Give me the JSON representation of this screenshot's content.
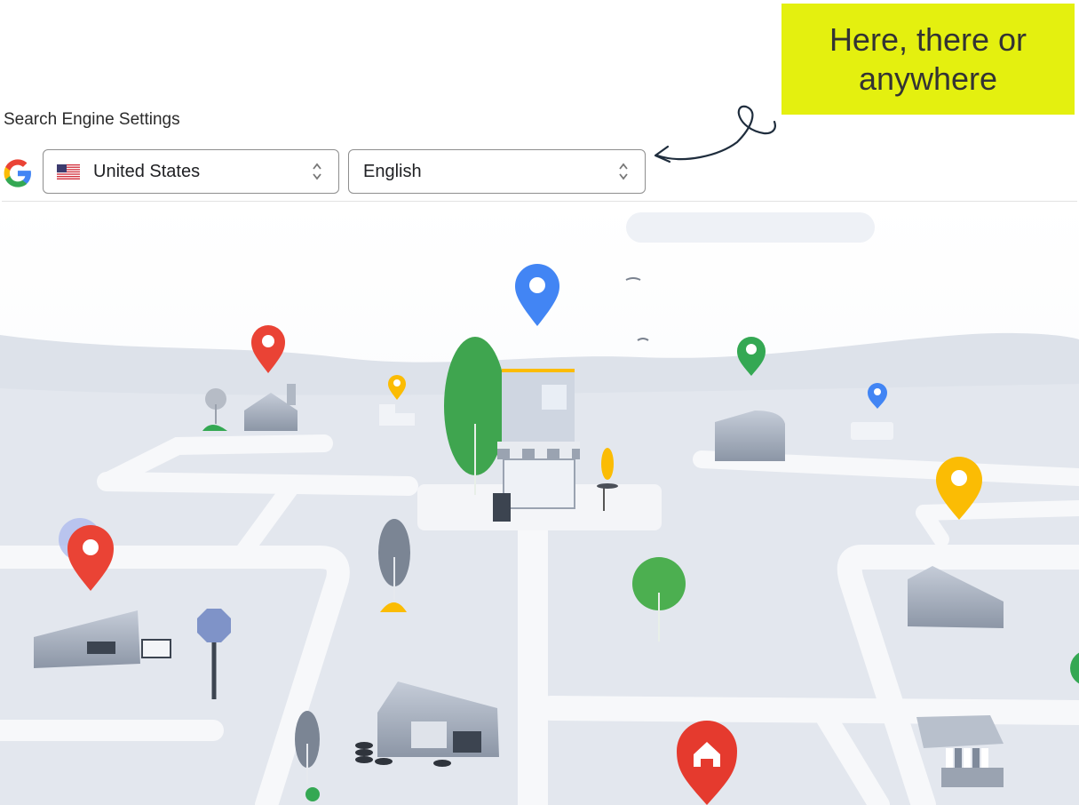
{
  "header": {
    "title": "Search Engine Settings"
  },
  "country_select": {
    "value": "United States",
    "flag": "us-flag-icon"
  },
  "language_select": {
    "value": "English"
  },
  "callout": {
    "text": "Here, there or\nanywhere"
  },
  "colors": {
    "callout_bg": "#e4f00f",
    "pin_red": "#ea4335",
    "pin_blue": "#4285f4",
    "pin_green": "#34a853",
    "pin_yellow": "#fbbc04",
    "road": "#f7f8fa",
    "ground": "#e3e7ee"
  }
}
